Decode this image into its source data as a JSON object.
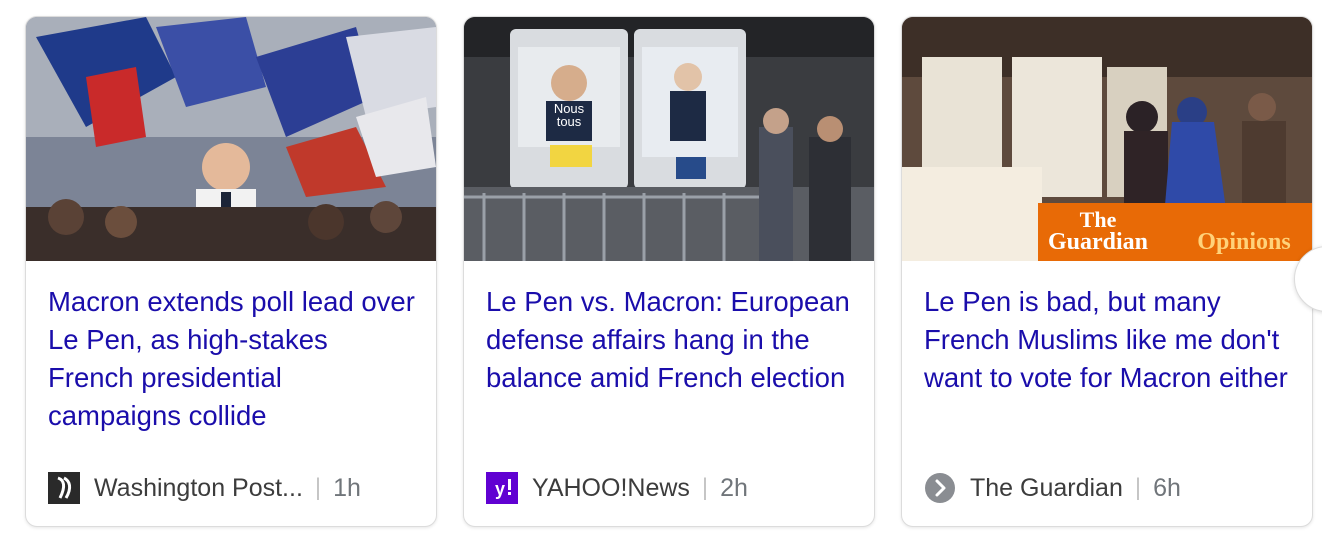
{
  "cards": [
    {
      "headline": "Macron extends poll lead over Le Pen, as high-stakes French presidential campaigns collide",
      "source": "Washington Post...",
      "age": "1h"
    },
    {
      "headline": "Le Pen vs. Macron: European defense affairs hang in the balance amid French election",
      "source": "YAHOO!News",
      "age": "2h",
      "poster_left_text": [
        "Nous",
        "tous"
      ]
    },
    {
      "headline": "Le Pen is bad, but many French Muslims like me don't want to vote for Macron either",
      "source": "The Guardian",
      "age": "6h",
      "watermark_brand": "The",
      "watermark_brand2": "Guardian",
      "watermark_section": "Opinions"
    }
  ],
  "source_separator": "|",
  "colors": {
    "headline": "#1a0dab",
    "yahoo_purple": "#6001d2",
    "guardian_orange": "#e05e00"
  },
  "icons": {
    "card1_logo": "washington-post-logo-icon",
    "card2_logo": "yahoo-logo-icon",
    "card3_logo": "guardian-chevron-icon",
    "carousel_next": "chevron-right-icon"
  }
}
